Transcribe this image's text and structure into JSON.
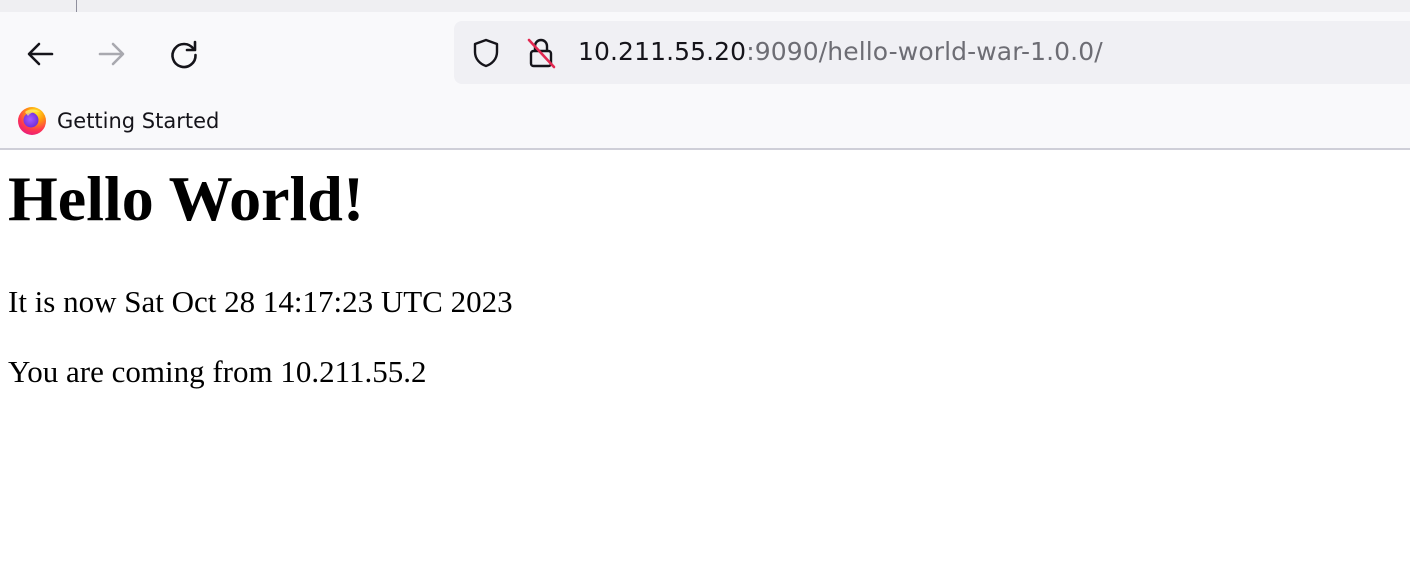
{
  "browser": {
    "url_host": "10.211.55.20",
    "url_rest": ":9090/hello-world-war-1.0.0/",
    "bookmarks": [
      {
        "label": "Getting Started",
        "icon": "firefox-logo-icon"
      }
    ],
    "icons": [
      "back-arrow-icon",
      "forward-arrow-icon",
      "reload-icon",
      "tracking-shield-icon",
      "insecure-lock-icon"
    ]
  },
  "page": {
    "heading": "Hello World!",
    "time_line": "It is now Sat Oct 28 14:17:23 UTC 2023",
    "from_line": "You are coming from 10.211.55.2"
  }
}
